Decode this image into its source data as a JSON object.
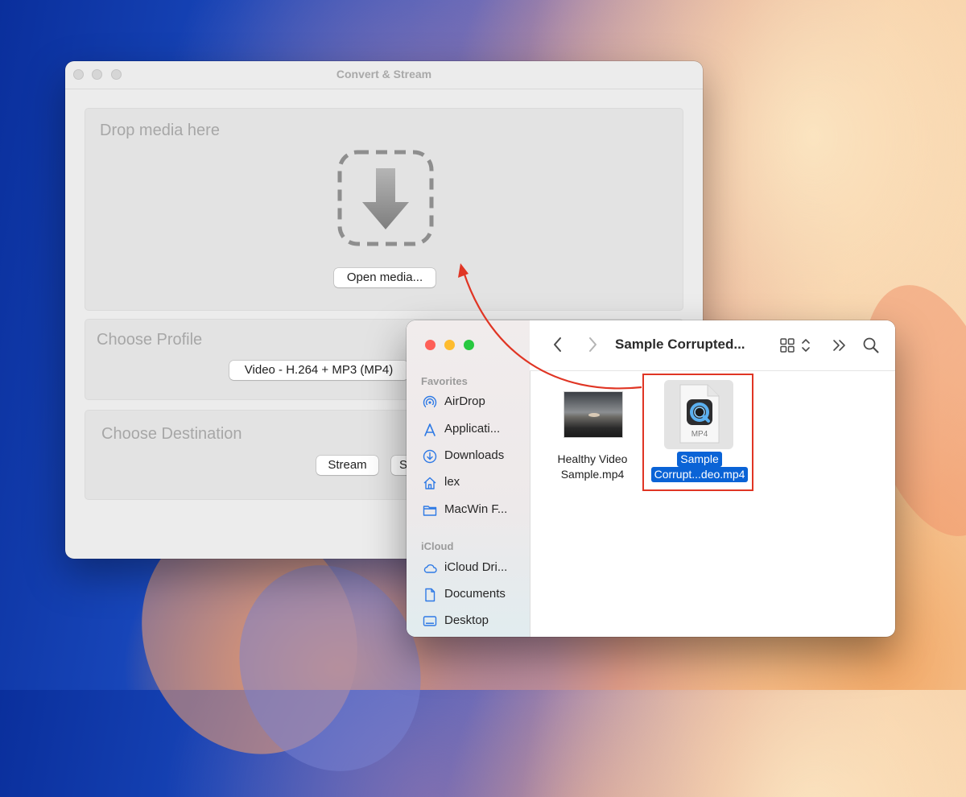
{
  "colors": {
    "accent": "#0a63d6",
    "annotation": "#e03524",
    "traffic_red": "#fe5f57",
    "traffic_yellow": "#febc2e",
    "traffic_green": "#28c840"
  },
  "convert_window": {
    "title": "Convert & Stream",
    "drop_panel": {
      "title": "Drop media here",
      "open_button": "Open media..."
    },
    "profile_panel": {
      "title": "Choose Profile",
      "profile_select": "Video - H.264 + MP3 (MP4)"
    },
    "destination_panel": {
      "title": "Choose Destination",
      "stream_button": "Stream",
      "save_button_partial": "S"
    }
  },
  "finder": {
    "folder_title": "Sample Corrupted...",
    "toolbar_icons": [
      "back-icon",
      "forward-icon",
      "grid-view-icon",
      "chevron-updown-icon",
      "more-icon",
      "search-icon"
    ],
    "sidebar": {
      "favorites_label": "Favorites",
      "favorites": [
        {
          "label": "AirDrop",
          "icon": "airdrop-icon"
        },
        {
          "label": "Applicati...",
          "icon": "applications-icon"
        },
        {
          "label": "Downloads",
          "icon": "downloads-icon"
        },
        {
          "label": "lex",
          "icon": "home-icon"
        },
        {
          "label": "MacWin F...",
          "icon": "folder-icon"
        }
      ],
      "icloud_label": "iCloud",
      "icloud": [
        {
          "label": "iCloud Dri...",
          "icon": "icloud-icon"
        },
        {
          "label": "Documents",
          "icon": "document-icon"
        },
        {
          "label": "Desktop",
          "icon": "desktop-icon"
        }
      ]
    },
    "files": [
      {
        "name_line1": "Healthy Video",
        "name_line2": "Sample.mp4",
        "selected": false
      },
      {
        "name_line1": "Sample",
        "name_line2": "Corrupt...deo.mp4",
        "selected": true,
        "type_label": "MP4"
      }
    ]
  }
}
